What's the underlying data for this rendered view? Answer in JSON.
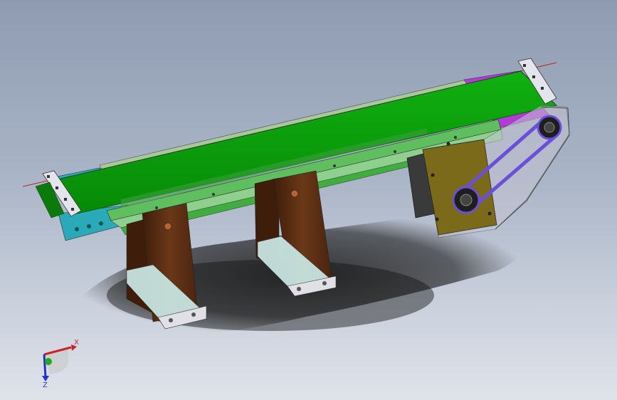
{
  "viewport": {
    "background_top": "#8e9bb1",
    "background_bottom": "#dfe3ea"
  },
  "model": {
    "belt_color": "#0a9a0a",
    "frame_color": "#5fbf5f",
    "leg_color": "#5a2e14",
    "motor_plate_color": "#7a6a1a",
    "drive_belt_color": "#6a4fd8",
    "guard_color": "#b8b8c4",
    "end_bracket_left_color": "#2aa9b8",
    "end_bracket_right_color": "#b23bd6",
    "baseplate_color": "#e0e0e6"
  },
  "triad": {
    "x_label": "X",
    "z_label": "Z",
    "x_color": "#cc2222",
    "y_color": "#22aa22",
    "z_color": "#2233cc"
  }
}
